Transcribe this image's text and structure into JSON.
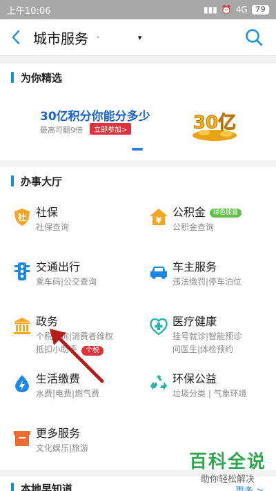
{
  "status_bar": {
    "time": "上午10:06",
    "network": "4G",
    "battery": "79"
  },
  "header": {
    "title": "城市服务",
    "dot": "·",
    "caret": "▾"
  },
  "for_you": {
    "title": "为你精选",
    "banner": {
      "title": "30亿积分你能分多少",
      "subtitle": "最高可翻9倍",
      "button": "立即参加>",
      "art_text": "30亿"
    }
  },
  "services": {
    "title": "办事大厅",
    "items": [
      {
        "name": "社保",
        "desc": "社保查询",
        "icon": "shield-icon"
      },
      {
        "name": "公积金",
        "desc": "公积金查询",
        "tag": "绿色能量",
        "icon": "house-yuan-icon"
      },
      {
        "name": "交通出行",
        "desc": "乘车码|公交查询",
        "icon": "traffic-light-icon"
      },
      {
        "name": "车主服务",
        "desc": "违法缴罚|停车泊位",
        "icon": "car-icon"
      },
      {
        "name": "政务",
        "desc": "个税查询|消费者维权",
        "desc2": "抵扣小助手",
        "tag": "个税",
        "icon": "government-building-icon"
      },
      {
        "name": "医疗健康",
        "desc": "挂号就诊|智能预诊",
        "desc2": "问医生|体检预约",
        "icon": "medical-cross-icon"
      },
      {
        "name": "生活缴费",
        "desc": "水费|电费|燃气费",
        "icon": "lightning-icon"
      },
      {
        "name": "环保公益",
        "desc": "垃圾分类 | 气象环境",
        "icon": "recycle-icon"
      },
      {
        "name": "更多服务",
        "desc": "文化娱乐|旅游",
        "icon": "box-icon"
      }
    ]
  },
  "local": {
    "title": "本地早知道",
    "more": "更多 >"
  },
  "watermark": {
    "line1": "百科全说",
    "line2": "助你轻松解决"
  },
  "colors": {
    "accent": "#108ee9",
    "orange": "#f5a623",
    "red": "#e0323b",
    "green": "#62c04a"
  }
}
